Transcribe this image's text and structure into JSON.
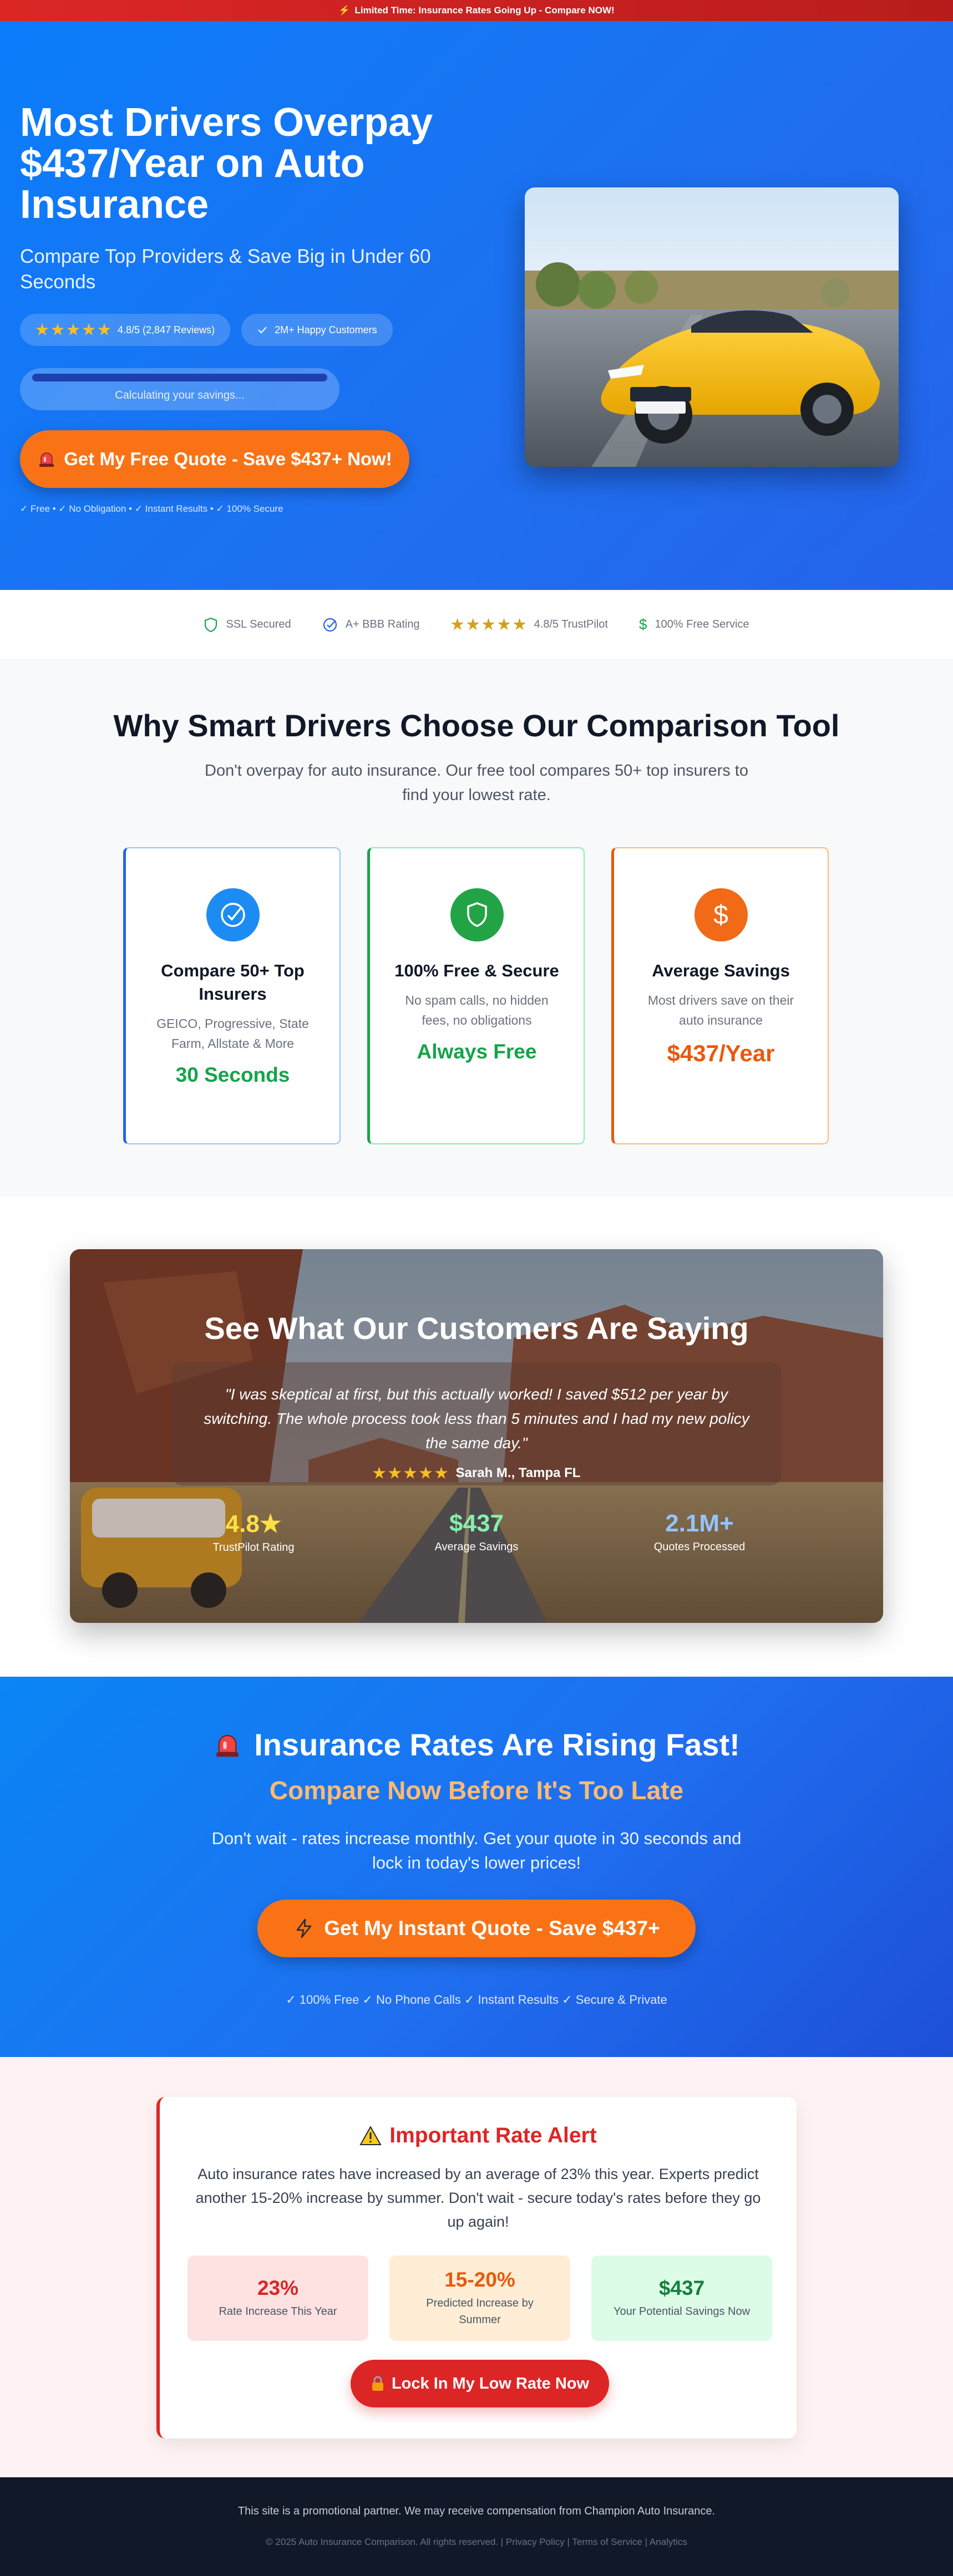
{
  "banner": {
    "icon": "lightning",
    "text": "Limited Time: Insurance Rates Going Up - Compare NOW!"
  },
  "hero": {
    "title": "Most Drivers Overpay $437/Year on Auto Insurance",
    "subtitle": "Compare Top Providers & Save Big in Under 60 Seconds",
    "rating_badge": "4.8/5 (2,847 Reviews)",
    "customers_badge": "2M+ Happy Customers",
    "progress_label": "Calculating your savings...",
    "progress_fraction": 1.0,
    "cta": "Get My Free Quote - Save $437+ Now!",
    "cta_icon": "siren-icon",
    "footnote": "✓ Free • ✓ No Obligation • ✓ Instant Results • ✓ 100% Secure"
  },
  "trust": {
    "ssl": "SSL Secured",
    "bbb": "A+ BBB Rating",
    "trustpilot": "4.8/5 TrustPilot",
    "free": "100% Free Service"
  },
  "why": {
    "title": "Why Smart Drivers Choose Our Comparison Tool",
    "subtitle": "Don't overpay for auto insurance. Our free tool compares 50+ top insurers to find your lowest rate.",
    "features": [
      {
        "title": "Compare 50+ Top Insurers",
        "desc": "GEICO, Progressive, State Farm, Allstate & More",
        "highlight": "30 Seconds",
        "color": "#16a34a",
        "icon": "check-circle-icon"
      },
      {
        "title": "100% Free & Secure",
        "desc": "No spam calls, no hidden fees, no obligations",
        "highlight": "Always Free",
        "color": "#16a34a",
        "icon": "shield-icon"
      },
      {
        "title": "Average Savings",
        "desc": "Most drivers save on their auto insurance",
        "highlight": "$437/Year",
        "color": "#ea580c",
        "icon": "dollar-icon"
      }
    ]
  },
  "testimonials": {
    "title": "See What Our Customers Are Saying",
    "quote": "\"I was skeptical at first, but this actually worked! I saved $512 per year by switching. The whole process took less than 5 minutes and I had my new policy the same day.\"",
    "author": "Sarah M., Tampa FL",
    "stats": [
      {
        "value": "4.8★",
        "label": "TrustPilot Rating",
        "color": "#fde047"
      },
      {
        "value": "$437",
        "label": "Average Savings",
        "color": "#86efac"
      },
      {
        "value": "2.1M+",
        "label": "Quotes Processed",
        "color": "#93c5fd"
      }
    ]
  },
  "rising": {
    "title": "Insurance Rates Are Rising Fast!",
    "subtitle": "Compare Now Before It's Too Late",
    "text": "Don't wait - rates increase monthly. Get your quote in 30 seconds and lock in today's lower prices!",
    "cta": "Get My Instant Quote - Save $437+",
    "footnote": "✓ 100% Free ✓ No Phone Calls ✓ Instant Results ✓ Secure & Private"
  },
  "alert": {
    "title": "Important Rate Alert",
    "text": "Auto insurance rates have increased by an average of 23% this year. Experts predict another 15-20% increase by summer. Don't wait - secure today's rates before they go up again!",
    "stats": [
      {
        "value": "23%",
        "label": "Rate Increase This Year",
        "color": "#dc2626",
        "bg": "#fee2e2"
      },
      {
        "value": "15-20%",
        "label": "Predicted Increase by Summer",
        "color": "#ea580c",
        "bg": "#ffedd5"
      },
      {
        "value": "$437",
        "label": "Your Potential Savings Now",
        "color": "#15803d",
        "bg": "#dcfce7"
      }
    ],
    "cta": "Lock In My Low Rate Now"
  },
  "footer": {
    "disclaimer": "This site is a promotional partner. We may receive compensation from Champion Auto Insurance.",
    "copyright": "© 2025 Auto Insurance Comparison. All rights reserved. |",
    "privacy": "Privacy Policy",
    "terms": "Terms of Service",
    "analytics": "Analytics"
  }
}
